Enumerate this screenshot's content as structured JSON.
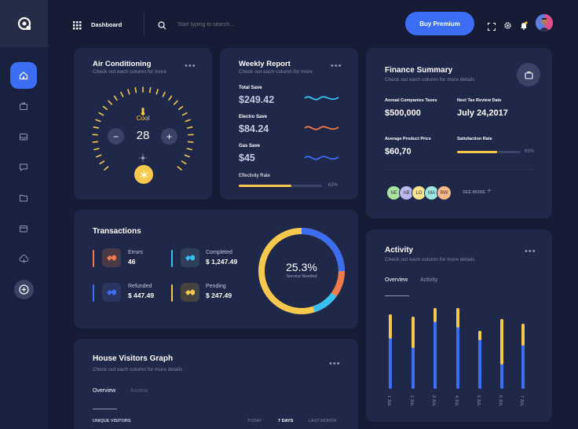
{
  "header": {
    "dashboard_label": "Dashboard",
    "search_placeholder": "Start typing to search...",
    "premium_button": "Buy Premium"
  },
  "air_conditioning": {
    "title": "Air Conditioning",
    "subtitle": "Check out each column for more",
    "mode": "Cool",
    "temperature": "28",
    "minus": "−",
    "plus": "+"
  },
  "weekly_report": {
    "title": "Weekly Report",
    "subtitle": "Check out each column for more",
    "items": [
      {
        "label": "Total Save",
        "value": "$249.42",
        "color": "#38c0f0"
      },
      {
        "label": "Electro Save",
        "value": "$84.24",
        "color": "#f07b4a"
      },
      {
        "label": "Gas Save",
        "value": "$45",
        "color": "#3b6ef5"
      }
    ],
    "rate_label": "Effectivity Rate",
    "rate_value": "63%",
    "rate_fraction": 0.63
  },
  "finance": {
    "title": "Finance Summary",
    "subtitle": "Check out each column for more details",
    "stats": [
      {
        "label": "Annual Companies Taxes",
        "value": "$500,000"
      },
      {
        "label": "Next Tax Review Date",
        "value": "July 24,2017"
      },
      {
        "label": "Average Product Price",
        "value": "$60,70"
      }
    ],
    "satisfaction_label": "Satisfaction Rate",
    "satisfaction_value": "63%",
    "satisfaction_fraction": 0.63,
    "avatars": [
      "NE",
      "AB",
      "LO",
      "MA",
      "RW"
    ],
    "see_more": "SEE MORE",
    "see_more_plus": "+"
  },
  "transactions": {
    "title": "Transactions",
    "items": [
      {
        "label": "Errors",
        "value": "46",
        "color": "#f07b4a"
      },
      {
        "label": "Completed",
        "value": "$ 1,247.49",
        "color": "#38c0f0"
      },
      {
        "label": "Refunded",
        "value": "$ 447.49",
        "color": "#3b6ef5"
      },
      {
        "label": "Pending",
        "value": "$ 247.49",
        "color": "#f6c94e"
      }
    ],
    "donut_value": "25.3%",
    "donut_label": "Service Needed"
  },
  "activity": {
    "title": "Activity",
    "subtitle": "Check out each column for more details",
    "tabs": [
      "Overview",
      "Activity"
    ],
    "dates": [
      "1 JUL",
      "2 JUL",
      "3 JUL",
      "4 JUL",
      "5 JUL",
      "6 JUL",
      "7 JUL"
    ]
  },
  "visitors": {
    "title": "House Visitors Graph",
    "subtitle": "Check out each column for more details",
    "tabs": [
      "Overview",
      "Access"
    ],
    "unique_label": "UNIQUE VISITORS",
    "ranges": [
      "TODAY",
      "7 DAYS",
      "LAST MONTH"
    ]
  },
  "colors": {
    "accent": "#3b6ef5",
    "yellow": "#f6c94e",
    "orange": "#f07b4a",
    "cyan": "#38c0f0"
  }
}
